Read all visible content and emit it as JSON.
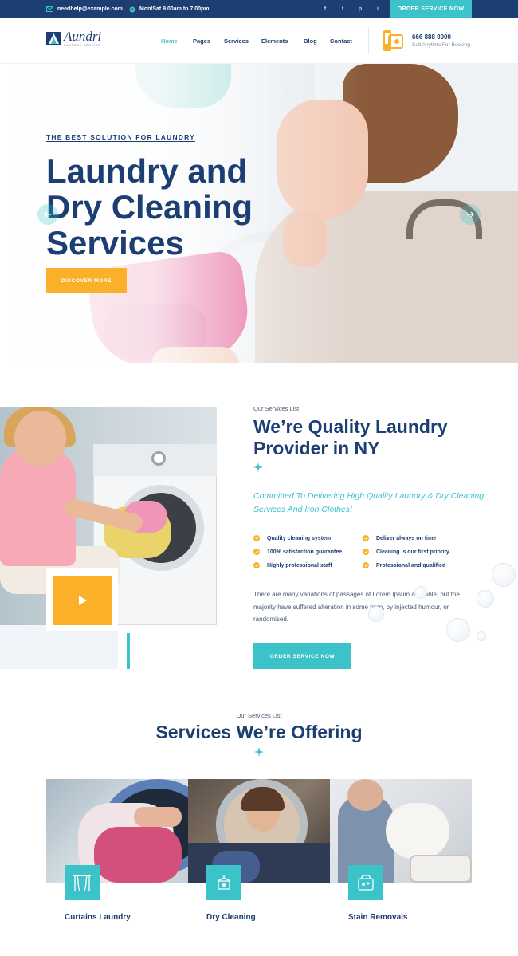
{
  "topbar": {
    "email": "needhelp@example.com",
    "hours": "Mon/Sat 9.00am to 7.00pm",
    "social": [
      "f",
      "t",
      "p",
      "i"
    ],
    "order_button": "ORDER SERVICE NOW"
  },
  "header": {
    "logo_name": "Aundri",
    "logo_tagline": "LAUNDRY SERVICE",
    "nav": [
      "Home",
      "Pages",
      "Services",
      "Elements",
      "Blog",
      "Contact"
    ],
    "active_nav": "Home",
    "phone": "666 888 0000",
    "phone_sub": "Call Anytime For Booking"
  },
  "hero": {
    "kicker": "THE BEST SOLUTION FOR LAUNDRY",
    "title": "Laundry and Dry Cleaning Services",
    "button": "DISCOVER MORE"
  },
  "about": {
    "kicker": "Our Services List",
    "title": "We’re Quality Laundry Provider in NY",
    "subtitle": "Committed To Delivering High Quality Laundry & Dry Cleaning Services And Iron Clothes!",
    "features_left": [
      "Quality cleaning system",
      "100% satisfaction guarantee",
      "Highly professional staff"
    ],
    "features_right": [
      "Deliver always on time",
      "Cleaning is our first priority",
      "Professional and qualified"
    ],
    "body": "There are many variations of passages of Lorem Ipsum available, but the majority have suffered alteration in some form, by injected humour, or randomised.",
    "button": "ORDER SERVICE NOW"
  },
  "services": {
    "kicker": "Our Services List",
    "title": "Services We’re Offering",
    "cards": [
      {
        "title": "Curtains Laundry",
        "icon": "curtains-icon"
      },
      {
        "title": "Dry Cleaning",
        "icon": "dry-cleaning-icon"
      },
      {
        "title": "Stain Removals",
        "icon": "stain-removal-icon"
      }
    ]
  },
  "colors": {
    "navy": "#1c3e72",
    "teal": "#3cc2c9",
    "yellow": "#fbb02a"
  }
}
